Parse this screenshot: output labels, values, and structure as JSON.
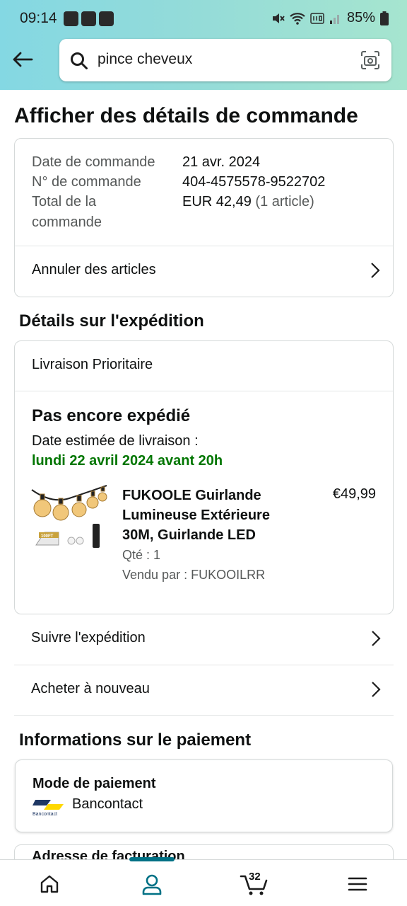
{
  "status_bar": {
    "time": "09:14",
    "battery": "85%"
  },
  "search": {
    "query": "pince cheveux"
  },
  "page": {
    "title": "Afficher des détails de commande"
  },
  "order_summary": {
    "date_label": "Date de commande",
    "date_value": "21 avr. 2024",
    "number_label": "N° de commande",
    "number_value": "404-4575578-9522702",
    "total_label_line1": "Total de la",
    "total_label_line2": "commande",
    "total_value": "EUR 42,49",
    "total_count": "(1 article)",
    "cancel_label": "Annuler des articles"
  },
  "shipping": {
    "section_title": "Détails sur l'expédition",
    "method": "Livraison Prioritaire",
    "status": "Pas encore expédié",
    "estimate_label": "Date estimée de livraison :",
    "estimate_value": "lundi 22 avril 2024 avant 20h",
    "product": {
      "title_line1": "FUKOOLE Guirlande",
      "title_line2": "Lumineuse Extérieure",
      "title_line3": "30M, Guirlande LED",
      "price": "€49,99",
      "quantity": "Qté : 1",
      "seller": "Vendu par : FUKOOILRR",
      "image_badge": "100FT"
    },
    "track_label": "Suivre l'expédition",
    "buy_again_label": "Acheter à nouveau"
  },
  "payment": {
    "section_title": "Informations sur le paiement",
    "mode_label": "Mode de paiement",
    "method_name": "Bancontact",
    "logo_text": "Bancontact",
    "billing_label": "Adresse de facturation"
  },
  "bottom_nav": {
    "cart_count": "32"
  },
  "colors": {
    "accent": "#007185",
    "delivery_green": "#007600",
    "header_start": "#84d8e3",
    "header_end": "#a6e5cf"
  }
}
